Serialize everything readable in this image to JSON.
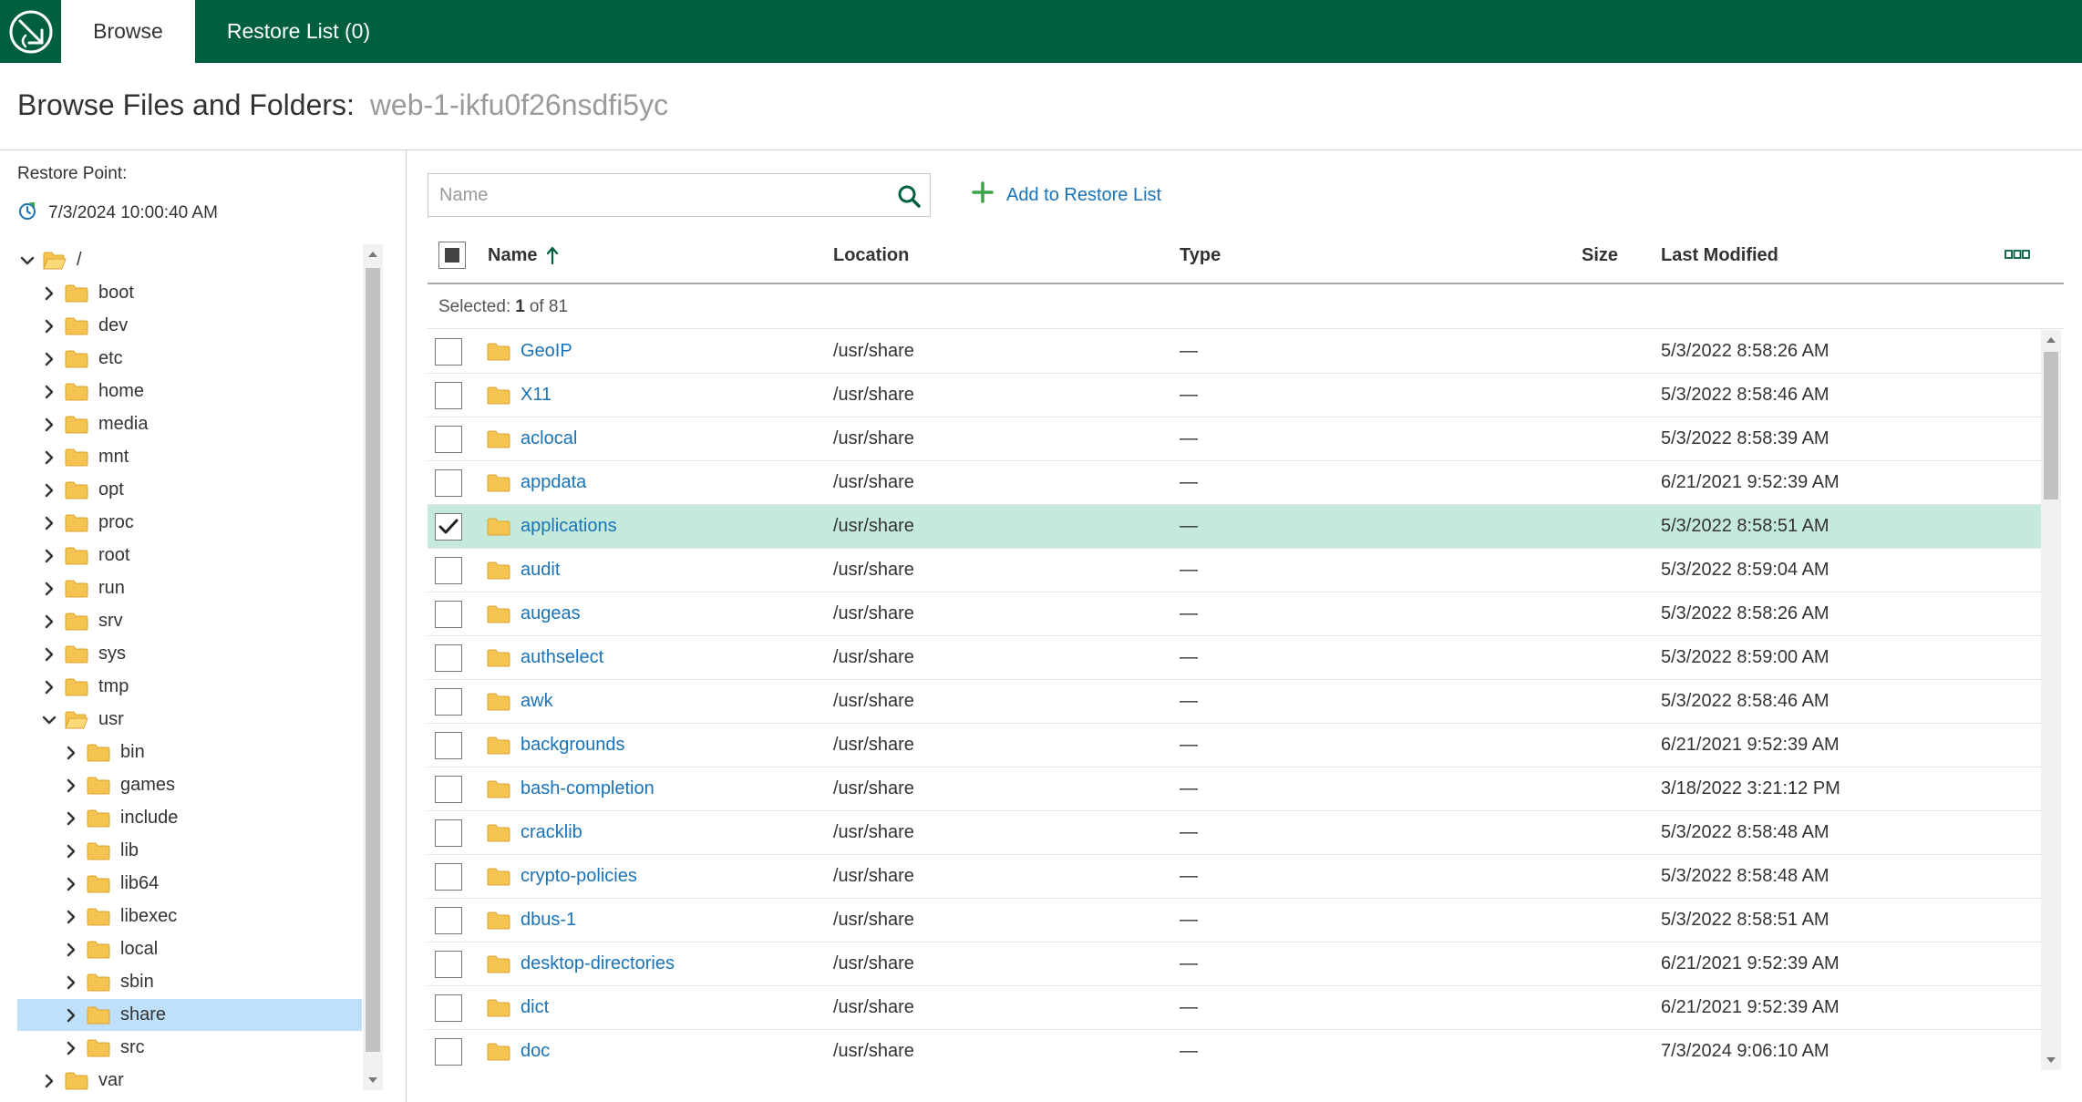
{
  "nav": {
    "logo_icon": "veeam-restore-logo-icon",
    "tabs": [
      {
        "label": "Browse",
        "active": true
      },
      {
        "label": "Restore List (0)",
        "active": false
      }
    ]
  },
  "header": {
    "title": "Browse Files and Folders:",
    "server": "web-1-ikfu0f26nsdfi5yc"
  },
  "restore_point": {
    "label": "Restore Point:",
    "value": "7/3/2024 10:00:40 AM",
    "icon": "restore-point-clock-icon"
  },
  "tree": {
    "items": [
      {
        "label": "/",
        "level": 0,
        "expanded": true,
        "selected": false
      },
      {
        "label": "boot",
        "level": 1,
        "expanded": false,
        "selected": false
      },
      {
        "label": "dev",
        "level": 1,
        "expanded": false,
        "selected": false
      },
      {
        "label": "etc",
        "level": 1,
        "expanded": false,
        "selected": false
      },
      {
        "label": "home",
        "level": 1,
        "expanded": false,
        "selected": false
      },
      {
        "label": "media",
        "level": 1,
        "expanded": false,
        "selected": false
      },
      {
        "label": "mnt",
        "level": 1,
        "expanded": false,
        "selected": false
      },
      {
        "label": "opt",
        "level": 1,
        "expanded": false,
        "selected": false
      },
      {
        "label": "proc",
        "level": 1,
        "expanded": false,
        "selected": false
      },
      {
        "label": "root",
        "level": 1,
        "expanded": false,
        "selected": false
      },
      {
        "label": "run",
        "level": 1,
        "expanded": false,
        "selected": false
      },
      {
        "label": "srv",
        "level": 1,
        "expanded": false,
        "selected": false
      },
      {
        "label": "sys",
        "level": 1,
        "expanded": false,
        "selected": false
      },
      {
        "label": "tmp",
        "level": 1,
        "expanded": false,
        "selected": false
      },
      {
        "label": "usr",
        "level": 1,
        "expanded": true,
        "selected": false
      },
      {
        "label": "bin",
        "level": 2,
        "expanded": false,
        "selected": false
      },
      {
        "label": "games",
        "level": 2,
        "expanded": false,
        "selected": false
      },
      {
        "label": "include",
        "level": 2,
        "expanded": false,
        "selected": false
      },
      {
        "label": "lib",
        "level": 2,
        "expanded": false,
        "selected": false
      },
      {
        "label": "lib64",
        "level": 2,
        "expanded": false,
        "selected": false
      },
      {
        "label": "libexec",
        "level": 2,
        "expanded": false,
        "selected": false
      },
      {
        "label": "local",
        "level": 2,
        "expanded": false,
        "selected": false
      },
      {
        "label": "sbin",
        "level": 2,
        "expanded": false,
        "selected": false
      },
      {
        "label": "share",
        "level": 2,
        "expanded": false,
        "selected": true
      },
      {
        "label": "src",
        "level": 2,
        "expanded": false,
        "selected": false
      },
      {
        "label": "var",
        "level": 1,
        "expanded": false,
        "selected": false
      }
    ]
  },
  "search": {
    "placeholder": "Name",
    "value": "",
    "icon": "search-icon"
  },
  "toolbar": {
    "add_label": "Add to Restore List",
    "add_icon": "plus-icon"
  },
  "table": {
    "columns": {
      "name": "Name",
      "location": "Location",
      "type": "Type",
      "size": "Size",
      "modified": "Last Modified"
    },
    "sort_icon": "sort-ascending-arrow-icon",
    "column_chooser_icon": "column-chooser-icon",
    "selection": {
      "prefix": "Selected:",
      "count": "1",
      "suffix": "of 81"
    },
    "rows": [
      {
        "name": "GeoIP",
        "location": "/usr/share",
        "type": "—",
        "size": "",
        "modified": "5/3/2022 8:58:26 AM",
        "checked": false
      },
      {
        "name": "X11",
        "location": "/usr/share",
        "type": "—",
        "size": "",
        "modified": "5/3/2022 8:58:46 AM",
        "checked": false
      },
      {
        "name": "aclocal",
        "location": "/usr/share",
        "type": "—",
        "size": "",
        "modified": "5/3/2022 8:58:39 AM",
        "checked": false
      },
      {
        "name": "appdata",
        "location": "/usr/share",
        "type": "—",
        "size": "",
        "modified": "6/21/2021 9:52:39 AM",
        "checked": false
      },
      {
        "name": "applications",
        "location": "/usr/share",
        "type": "—",
        "size": "",
        "modified": "5/3/2022 8:58:51 AM",
        "checked": true
      },
      {
        "name": "audit",
        "location": "/usr/share",
        "type": "—",
        "size": "",
        "modified": "5/3/2022 8:59:04 AM",
        "checked": false
      },
      {
        "name": "augeas",
        "location": "/usr/share",
        "type": "—",
        "size": "",
        "modified": "5/3/2022 8:58:26 AM",
        "checked": false
      },
      {
        "name": "authselect",
        "location": "/usr/share",
        "type": "—",
        "size": "",
        "modified": "5/3/2022 8:59:00 AM",
        "checked": false
      },
      {
        "name": "awk",
        "location": "/usr/share",
        "type": "—",
        "size": "",
        "modified": "5/3/2022 8:58:46 AM",
        "checked": false
      },
      {
        "name": "backgrounds",
        "location": "/usr/share",
        "type": "—",
        "size": "",
        "modified": "6/21/2021 9:52:39 AM",
        "checked": false
      },
      {
        "name": "bash-completion",
        "location": "/usr/share",
        "type": "—",
        "size": "",
        "modified": "3/18/2022 3:21:12 PM",
        "checked": false
      },
      {
        "name": "cracklib",
        "location": "/usr/share",
        "type": "—",
        "size": "",
        "modified": "5/3/2022 8:58:48 AM",
        "checked": false
      },
      {
        "name": "crypto-policies",
        "location": "/usr/share",
        "type": "—",
        "size": "",
        "modified": "5/3/2022 8:58:48 AM",
        "checked": false
      },
      {
        "name": "dbus-1",
        "location": "/usr/share",
        "type": "—",
        "size": "",
        "modified": "5/3/2022 8:58:51 AM",
        "checked": false
      },
      {
        "name": "desktop-directories",
        "location": "/usr/share",
        "type": "—",
        "size": "",
        "modified": "6/21/2021 9:52:39 AM",
        "checked": false
      },
      {
        "name": "dict",
        "location": "/usr/share",
        "type": "—",
        "size": "",
        "modified": "6/21/2021 9:52:39 AM",
        "checked": false
      },
      {
        "name": "doc",
        "location": "/usr/share",
        "type": "—",
        "size": "",
        "modified": "7/3/2024 9:06:10 AM",
        "checked": false
      }
    ]
  },
  "colors": {
    "brand": "#005f3f",
    "link": "#1a73b8",
    "add_icon": "#3aa345",
    "folder": "#f5c450",
    "row_checked": "#c5eadb",
    "tree_selected": "#bfe0fa"
  }
}
